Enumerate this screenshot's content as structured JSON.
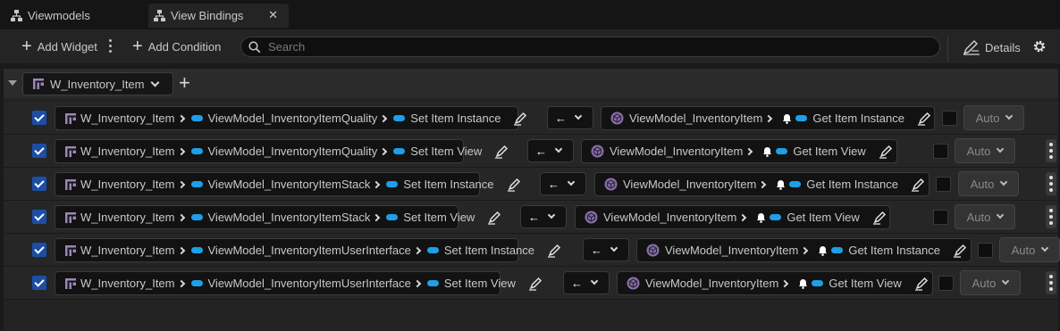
{
  "tabs": [
    {
      "label": "Viewmodels",
      "active": false
    },
    {
      "label": "View Bindings",
      "active": true
    }
  ],
  "toolbar": {
    "add_widget_label": "Add Widget",
    "add_condition_label": "Add Condition",
    "search_placeholder": "Search",
    "details_label": "Details"
  },
  "widget_header": {
    "name": "W_Inventory_Item"
  },
  "colors": {
    "accent": "#1e9fe8",
    "checkbox": "#1c4ea6",
    "viewmodel_icon": "#8a6bb0"
  },
  "bindings": [
    {
      "widget": "W_Inventory_Item",
      "viewmodel_prop": "ViewModel_InventoryItemQuality",
      "widget_func": "Set Item Instance",
      "mode": "←",
      "source_vm": "ViewModel_InventoryItem",
      "source_func": "Get Item Instance",
      "execution": "Auto",
      "enabled": true
    },
    {
      "widget": "W_Inventory_Item",
      "viewmodel_prop": "ViewModel_InventoryItemQuality",
      "widget_func": "Set Item View",
      "mode": "←",
      "source_vm": "ViewModel_InventoryItem",
      "source_func": "Get Item View",
      "execution": "Auto",
      "enabled": true
    },
    {
      "widget": "W_Inventory_Item",
      "viewmodel_prop": "ViewModel_InventoryItemStack",
      "widget_func": "Set Item Instance",
      "mode": "←",
      "source_vm": "ViewModel_InventoryItem",
      "source_func": "Get Item Instance",
      "execution": "Auto",
      "enabled": true
    },
    {
      "widget": "W_Inventory_Item",
      "viewmodel_prop": "ViewModel_InventoryItemStack",
      "widget_func": "Set Item View",
      "mode": "←",
      "source_vm": "ViewModel_InventoryItem",
      "source_func": "Get Item View",
      "execution": "Auto",
      "enabled": true
    },
    {
      "widget": "W_Inventory_Item",
      "viewmodel_prop": "ViewModel_InventoryItemUserInterface",
      "widget_func": "Set Item Instance",
      "mode": "←",
      "source_vm": "ViewModel_InventoryItem",
      "source_func": "Get Item Instance",
      "execution": "Auto",
      "enabled": true
    },
    {
      "widget": "W_Inventory_Item",
      "viewmodel_prop": "ViewModel_InventoryItemUserInterface",
      "widget_func": "Set Item View",
      "mode": "←",
      "source_vm": "ViewModel_InventoryItem",
      "source_func": "Get Item View",
      "execution": "Auto",
      "enabled": true
    }
  ]
}
